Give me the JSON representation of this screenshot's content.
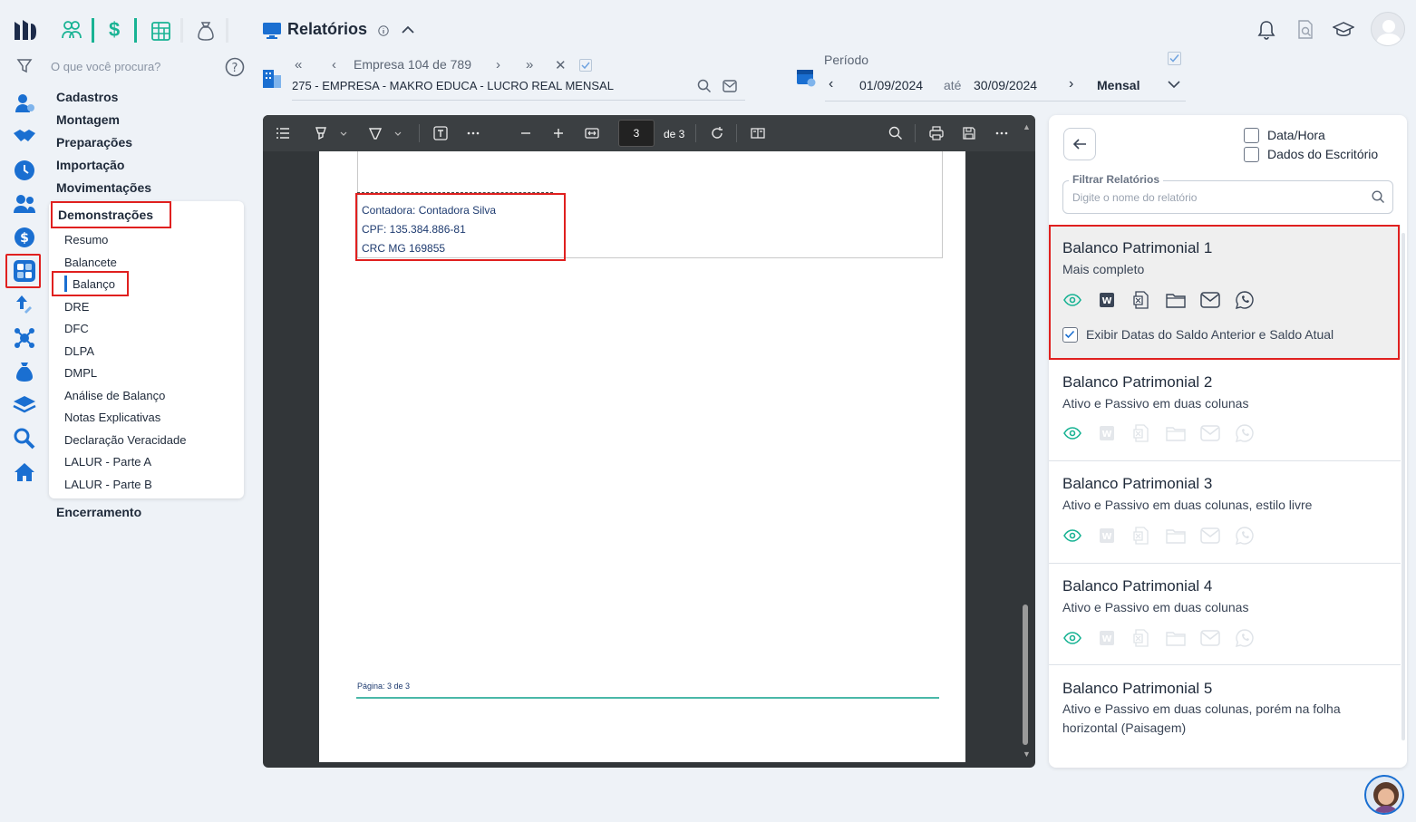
{
  "app": {
    "logo": "app-logo"
  },
  "top_tabs": [
    {
      "icon": "people-icon"
    },
    {
      "icon": "dollar-icon"
    },
    {
      "icon": "table-icon"
    },
    {
      "icon": "money-bag-icon"
    }
  ],
  "search": {
    "placeholder": "O que você procura?"
  },
  "menu": {
    "items": [
      "Cadastros",
      "Montagem",
      "Preparações",
      "Importação",
      "Movimentações",
      "Demonstrações",
      "Encerramento"
    ],
    "submenu": [
      "Resumo",
      "Balancete",
      "Balanço",
      "DRE",
      "DFC",
      "DLPA",
      "DMPL",
      "Análise de Balanço",
      "Notas Explicativas",
      "Declaração Veracidade",
      "LALUR - Parte A",
      "LALUR - Parte B"
    ]
  },
  "header": {
    "title": "Relatórios"
  },
  "company_nav": {
    "prefix": "Empresa",
    "current": "104",
    "de": "de",
    "total": "789",
    "company_name": "275 - EMPRESA - MAKRO EDUCA - LUCRO REAL MENSAL"
  },
  "period": {
    "label": "Período",
    "start": "01/09/2024",
    "ate": "até",
    "end": "30/09/2024",
    "mode": "Mensal"
  },
  "viewer": {
    "page_current": "3",
    "page_total_label": "de 3",
    "signature_lines": [
      "Contadora: Contadora Silva",
      "CPF: 135.384.886-81",
      "CRC MG 169855"
    ],
    "footer": "Página: 3 de 3"
  },
  "panel": {
    "checkbox_datetime": "Data/Hora",
    "checkbox_office": "Dados do Escritório",
    "filter_label": "Filtrar Relatórios",
    "filter_placeholder": "Digite o nome do relatório",
    "reports": [
      {
        "title": "Balanco Patrimonial 1",
        "subtitle": "Mais completo",
        "option": "Exibir Datas do Saldo Anterior e Saldo Atual"
      },
      {
        "title": "Balanco Patrimonial 2",
        "subtitle": "Ativo e Passivo em duas colunas"
      },
      {
        "title": "Balanco Patrimonial 3",
        "subtitle": "Ativo e Passivo em duas colunas, estilo livre"
      },
      {
        "title": "Balanco Patrimonial 4",
        "subtitle": "Ativo e Passivo em duas colunas"
      },
      {
        "title": "Balanco Patrimonial 5",
        "subtitle": "Ativo e Passivo em duas colunas, porém na folha horizontal (Paisagem)"
      }
    ]
  },
  "colors": {
    "accent_green": "#19b394",
    "accent_blue": "#1a6fd1",
    "highlight_red": "#e0201f"
  }
}
